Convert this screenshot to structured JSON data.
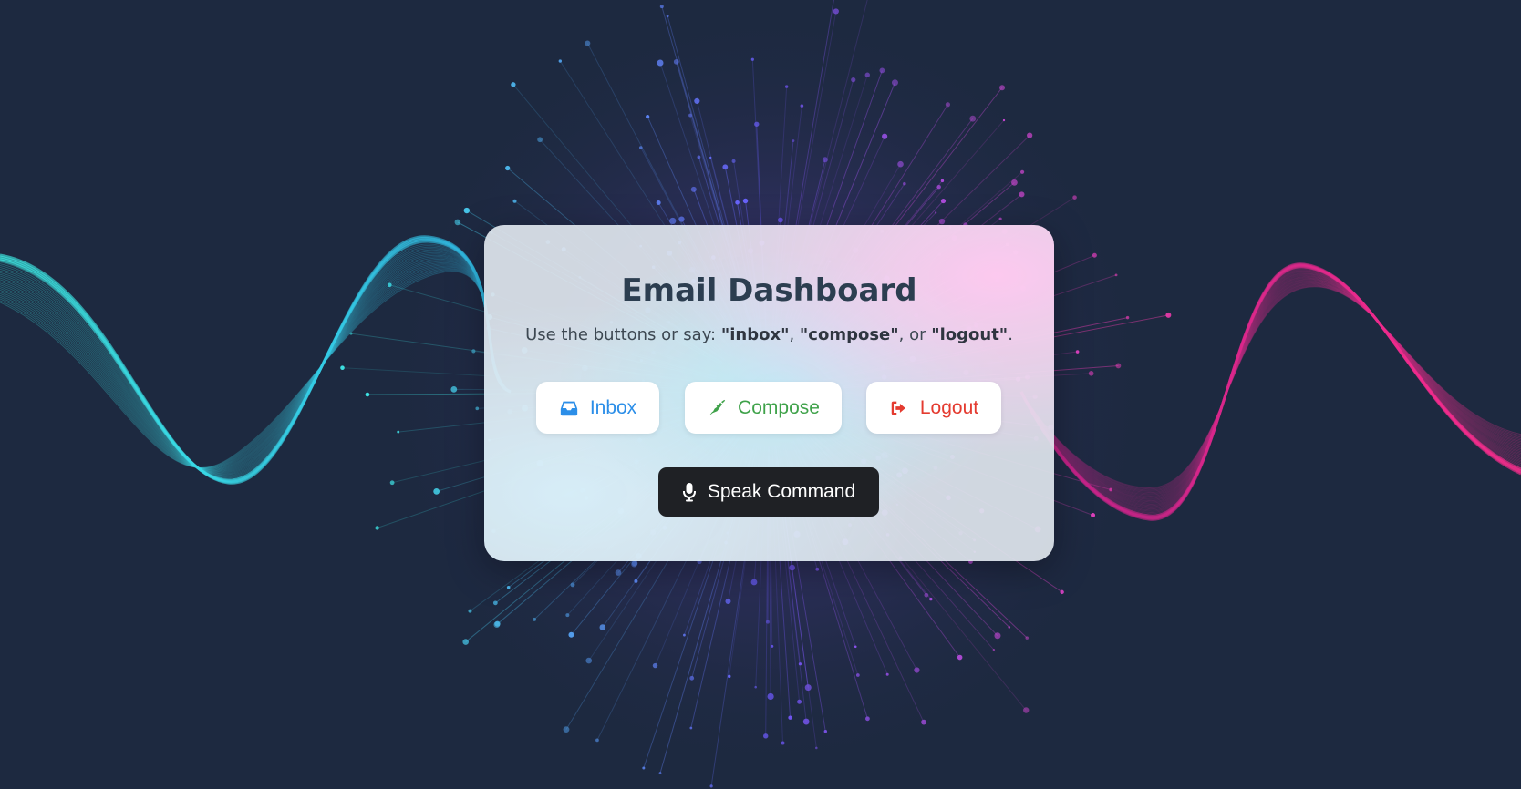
{
  "dashboard": {
    "title": "Email Dashboard",
    "subtitle": {
      "prefix": "Use the buttons or say: ",
      "cmd_inbox": "\"inbox\"",
      "sep1": ", ",
      "cmd_compose": "\"compose\"",
      "sep2": ", or ",
      "cmd_logout": "\"logout\"",
      "suffix": "."
    },
    "buttons": {
      "inbox": {
        "label": "Inbox",
        "icon": "inbox-icon",
        "color": "#2b8ee8"
      },
      "compose": {
        "label": "Compose",
        "icon": "pen-icon",
        "color": "#3fa24a"
      },
      "logout": {
        "label": "Logout",
        "icon": "sign-out-icon",
        "color": "#e43b30"
      }
    },
    "speak": {
      "label": "Speak Command",
      "icon": "microphone-icon"
    }
  },
  "colors": {
    "background": "#1d2940",
    "wave_left": "#3ee6e6",
    "wave_right": "#ff2d8f",
    "title": "#2c3e50",
    "speak_button": "#1f2125"
  }
}
